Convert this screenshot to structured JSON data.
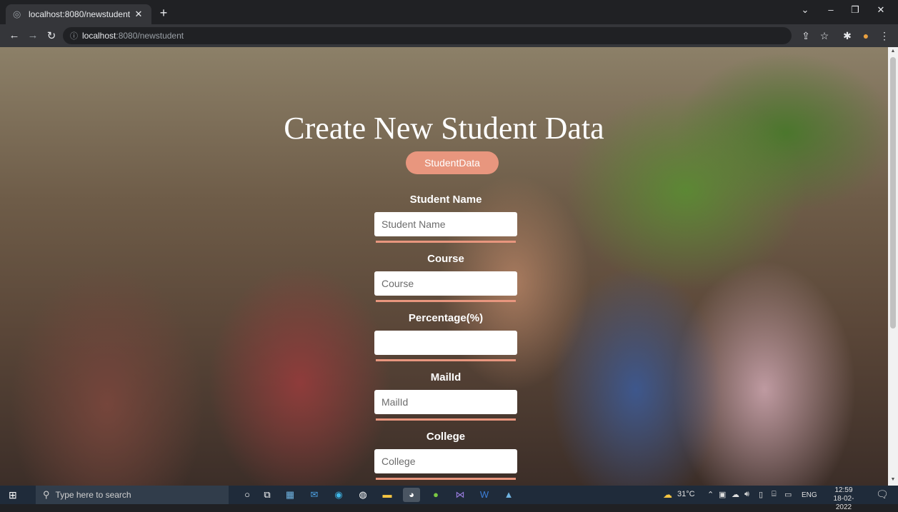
{
  "browser": {
    "tab_title": "localhost:8080/newstudent",
    "url_host": "localhost",
    "url_path": ":8080/newstudent"
  },
  "page": {
    "title": "Create New Student Data",
    "pill_button": "StudentData",
    "fields": [
      {
        "label": "Student Name",
        "placeholder": "Student Name"
      },
      {
        "label": "Course",
        "placeholder": "Course"
      },
      {
        "label": "Percentage(%)",
        "placeholder": ""
      },
      {
        "label": "MailId",
        "placeholder": "MailId"
      },
      {
        "label": "College",
        "placeholder": "College"
      }
    ]
  },
  "taskbar": {
    "search_placeholder": "Type here to search",
    "weather": "31°C",
    "language": "ENG",
    "time": "12:59",
    "date": "18-02-2022"
  },
  "colors": {
    "accent": "#e8967e",
    "chrome_dark": "#202124",
    "chrome_mid": "#35363a",
    "taskbar": "#1f2b3a"
  }
}
